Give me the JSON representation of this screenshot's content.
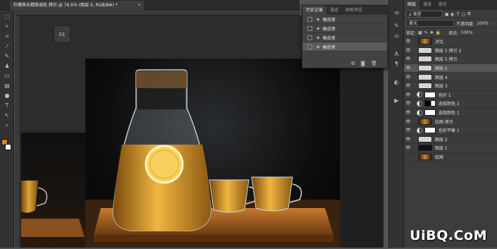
{
  "document": {
    "tab_title": "柠檬茶水精修调色 拷贝 @ 76.6% (图层 5, RGB/8#) *",
    "close": "×"
  },
  "colors": {
    "foreground": "#d88321",
    "background": "#ffffff"
  },
  "history": {
    "tabs": [
      "历史记录",
      "通道",
      "画笔预设"
    ],
    "items": [
      "橡皮擦",
      "橡皮擦",
      "橡皮擦",
      "橡皮擦"
    ],
    "selected_index": 3
  },
  "layers_panel": {
    "tabs": [
      "图层",
      "通道",
      "路径"
    ],
    "filter": "ρ 类型",
    "blend_mode": "柔光",
    "opacity_label": "不透明度:",
    "opacity_value": "100%",
    "lock_label": "锁定:",
    "fill_label": "填充:",
    "fill_value": "100%",
    "layers": [
      {
        "name": "对比",
        "visible": true,
        "kind": "image"
      },
      {
        "name": "图层 5 拷贝 2",
        "visible": true,
        "kind": "trans"
      },
      {
        "name": "图层 5 拷贝",
        "visible": true,
        "kind": "trans"
      },
      {
        "name": "图层 5",
        "visible": true,
        "kind": "trans",
        "selected": true
      },
      {
        "name": "图层 4",
        "visible": true,
        "kind": "trans"
      },
      {
        "name": "图层 3",
        "visible": true,
        "kind": "trans"
      },
      {
        "name": "色阶 1",
        "visible": true,
        "kind": "adj"
      },
      {
        "name": "选取颜色 2",
        "visible": true,
        "kind": "adj-dark"
      },
      {
        "name": "选取颜色 1",
        "visible": true,
        "kind": "adj"
      },
      {
        "name": "绘图 拷贝",
        "visible": true,
        "kind": "image"
      },
      {
        "name": "色彩平衡 1",
        "visible": true,
        "kind": "adj"
      },
      {
        "name": "图层 2",
        "visible": true,
        "kind": "trans"
      },
      {
        "name": "图层 1",
        "visible": true,
        "kind": "dark"
      },
      {
        "name": "绘图",
        "visible": false,
        "kind": "image"
      }
    ]
  },
  "float_button": "01",
  "watermark": "UiBQ.CoM"
}
